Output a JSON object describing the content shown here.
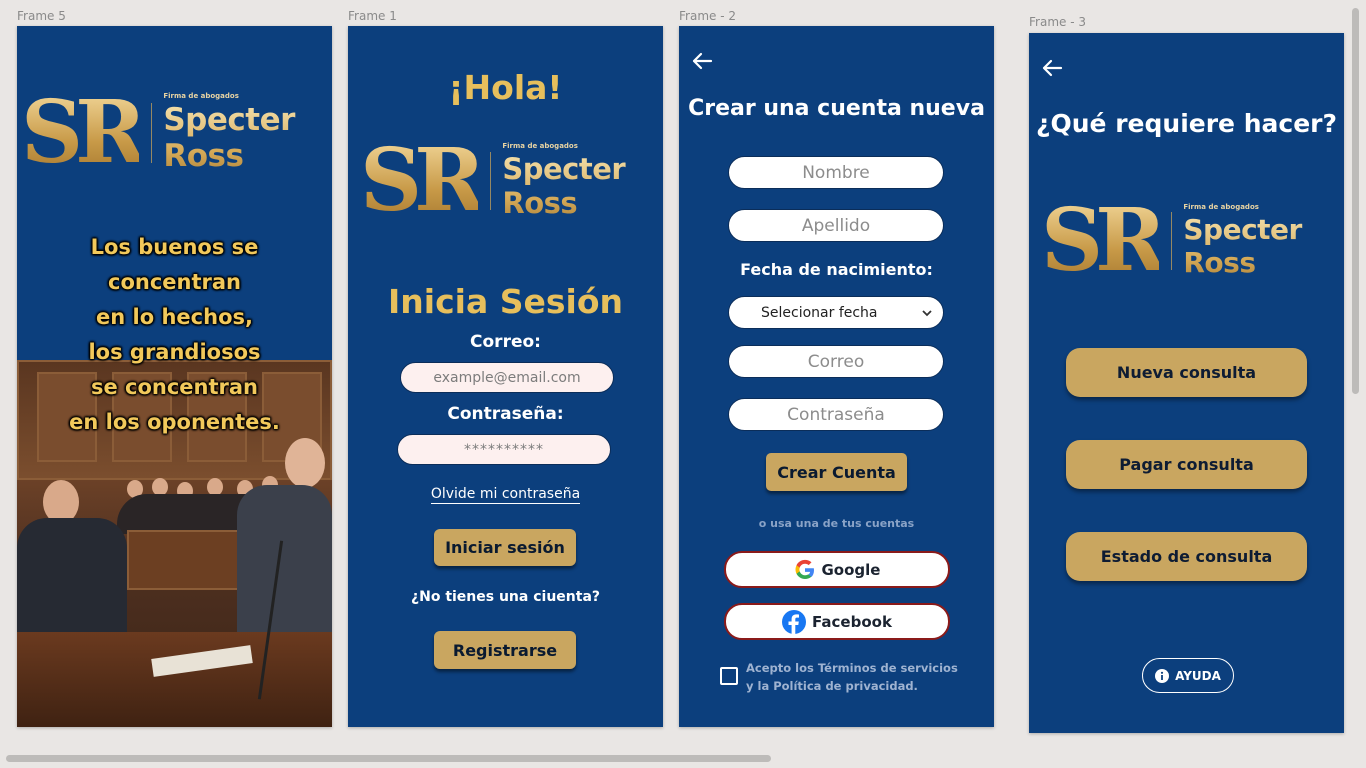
{
  "frames": {
    "f5": "Frame 5",
    "f1": "Frame 1",
    "f2": "Frame - 2",
    "f3": "Frame - 3"
  },
  "brand": {
    "monogram": "SR",
    "tagline": "Firma de abogados",
    "name": "Specter Ross"
  },
  "frame5": {
    "quote": [
      "Los buenos se",
      "concentran",
      "en lo hechos,",
      "los grandiosos",
      "se concentran",
      "en los oponentes."
    ]
  },
  "frame1": {
    "greeting": "¡Hola!",
    "title": "Inicia Sesión",
    "email_label": "Correo:",
    "email_placeholder": "example@email.com",
    "password_label": "Contraseña:",
    "password_value": "**********",
    "forgot_link": "Olvide mi contraseña",
    "login_button": "Iniciar sesión",
    "no_account": "¿No tienes una ciuenta?",
    "register_button": "Registrarse"
  },
  "frame2": {
    "title": "Crear una cuenta nueva",
    "first_name": "Nombre",
    "last_name": "Apellido",
    "dob_label": "Fecha de nacimiento:",
    "dob_select": "Selecionar fecha",
    "email": "Correo",
    "password": "Contraseña",
    "create_button": "Crear Cuenta",
    "or_text": "o usa una de tus cuentas",
    "google": "Google",
    "facebook": "Facebook",
    "terms_line1": "Acepto los Términos de servicios",
    "terms_line2": "y la Política de privacidad."
  },
  "frame3": {
    "title": "¿Qué requiere hacer?",
    "new_consult": "Nueva consulta",
    "pay_consult": "Pagar consulta",
    "status_consult": "Estado de consulta",
    "help": "AYUDA"
  },
  "colors": {
    "frame_bg": "#0c3f7d",
    "gold": "#c9a660",
    "canvas": "#e9e6e4"
  }
}
